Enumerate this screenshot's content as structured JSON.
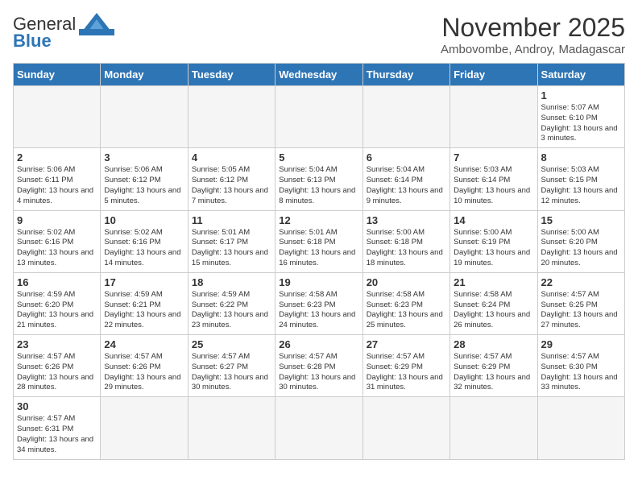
{
  "header": {
    "logo_general": "General",
    "logo_blue": "Blue",
    "month_year": "November 2025",
    "location": "Ambovombe, Androy, Madagascar"
  },
  "days_of_week": [
    "Sunday",
    "Monday",
    "Tuesday",
    "Wednesday",
    "Thursday",
    "Friday",
    "Saturday"
  ],
  "weeks": [
    [
      {
        "day": "",
        "info": ""
      },
      {
        "day": "",
        "info": ""
      },
      {
        "day": "",
        "info": ""
      },
      {
        "day": "",
        "info": ""
      },
      {
        "day": "",
        "info": ""
      },
      {
        "day": "",
        "info": ""
      },
      {
        "day": "1",
        "info": "Sunrise: 5:07 AM\nSunset: 6:10 PM\nDaylight: 13 hours and 3 minutes."
      }
    ],
    [
      {
        "day": "2",
        "info": "Sunrise: 5:06 AM\nSunset: 6:11 PM\nDaylight: 13 hours and 4 minutes."
      },
      {
        "day": "3",
        "info": "Sunrise: 5:06 AM\nSunset: 6:12 PM\nDaylight: 13 hours and 5 minutes."
      },
      {
        "day": "4",
        "info": "Sunrise: 5:05 AM\nSunset: 6:12 PM\nDaylight: 13 hours and 7 minutes."
      },
      {
        "day": "5",
        "info": "Sunrise: 5:04 AM\nSunset: 6:13 PM\nDaylight: 13 hours and 8 minutes."
      },
      {
        "day": "6",
        "info": "Sunrise: 5:04 AM\nSunset: 6:14 PM\nDaylight: 13 hours and 9 minutes."
      },
      {
        "day": "7",
        "info": "Sunrise: 5:03 AM\nSunset: 6:14 PM\nDaylight: 13 hours and 10 minutes."
      },
      {
        "day": "8",
        "info": "Sunrise: 5:03 AM\nSunset: 6:15 PM\nDaylight: 13 hours and 12 minutes."
      }
    ],
    [
      {
        "day": "9",
        "info": "Sunrise: 5:02 AM\nSunset: 6:16 PM\nDaylight: 13 hours and 13 minutes."
      },
      {
        "day": "10",
        "info": "Sunrise: 5:02 AM\nSunset: 6:16 PM\nDaylight: 13 hours and 14 minutes."
      },
      {
        "day": "11",
        "info": "Sunrise: 5:01 AM\nSunset: 6:17 PM\nDaylight: 13 hours and 15 minutes."
      },
      {
        "day": "12",
        "info": "Sunrise: 5:01 AM\nSunset: 6:18 PM\nDaylight: 13 hours and 16 minutes."
      },
      {
        "day": "13",
        "info": "Sunrise: 5:00 AM\nSunset: 6:18 PM\nDaylight: 13 hours and 18 minutes."
      },
      {
        "day": "14",
        "info": "Sunrise: 5:00 AM\nSunset: 6:19 PM\nDaylight: 13 hours and 19 minutes."
      },
      {
        "day": "15",
        "info": "Sunrise: 5:00 AM\nSunset: 6:20 PM\nDaylight: 13 hours and 20 minutes."
      }
    ],
    [
      {
        "day": "16",
        "info": "Sunrise: 4:59 AM\nSunset: 6:20 PM\nDaylight: 13 hours and 21 minutes."
      },
      {
        "day": "17",
        "info": "Sunrise: 4:59 AM\nSunset: 6:21 PM\nDaylight: 13 hours and 22 minutes."
      },
      {
        "day": "18",
        "info": "Sunrise: 4:59 AM\nSunset: 6:22 PM\nDaylight: 13 hours and 23 minutes."
      },
      {
        "day": "19",
        "info": "Sunrise: 4:58 AM\nSunset: 6:23 PM\nDaylight: 13 hours and 24 minutes."
      },
      {
        "day": "20",
        "info": "Sunrise: 4:58 AM\nSunset: 6:23 PM\nDaylight: 13 hours and 25 minutes."
      },
      {
        "day": "21",
        "info": "Sunrise: 4:58 AM\nSunset: 6:24 PM\nDaylight: 13 hours and 26 minutes."
      },
      {
        "day": "22",
        "info": "Sunrise: 4:57 AM\nSunset: 6:25 PM\nDaylight: 13 hours and 27 minutes."
      }
    ],
    [
      {
        "day": "23",
        "info": "Sunrise: 4:57 AM\nSunset: 6:26 PM\nDaylight: 13 hours and 28 minutes."
      },
      {
        "day": "24",
        "info": "Sunrise: 4:57 AM\nSunset: 6:26 PM\nDaylight: 13 hours and 29 minutes."
      },
      {
        "day": "25",
        "info": "Sunrise: 4:57 AM\nSunset: 6:27 PM\nDaylight: 13 hours and 30 minutes."
      },
      {
        "day": "26",
        "info": "Sunrise: 4:57 AM\nSunset: 6:28 PM\nDaylight: 13 hours and 30 minutes."
      },
      {
        "day": "27",
        "info": "Sunrise: 4:57 AM\nSunset: 6:29 PM\nDaylight: 13 hours and 31 minutes."
      },
      {
        "day": "28",
        "info": "Sunrise: 4:57 AM\nSunset: 6:29 PM\nDaylight: 13 hours and 32 minutes."
      },
      {
        "day": "29",
        "info": "Sunrise: 4:57 AM\nSunset: 6:30 PM\nDaylight: 13 hours and 33 minutes."
      }
    ],
    [
      {
        "day": "30",
        "info": "Sunrise: 4:57 AM\nSunset: 6:31 PM\nDaylight: 13 hours and 34 minutes."
      },
      {
        "day": "",
        "info": ""
      },
      {
        "day": "",
        "info": ""
      },
      {
        "day": "",
        "info": ""
      },
      {
        "day": "",
        "info": ""
      },
      {
        "day": "",
        "info": ""
      },
      {
        "day": "",
        "info": ""
      }
    ]
  ]
}
